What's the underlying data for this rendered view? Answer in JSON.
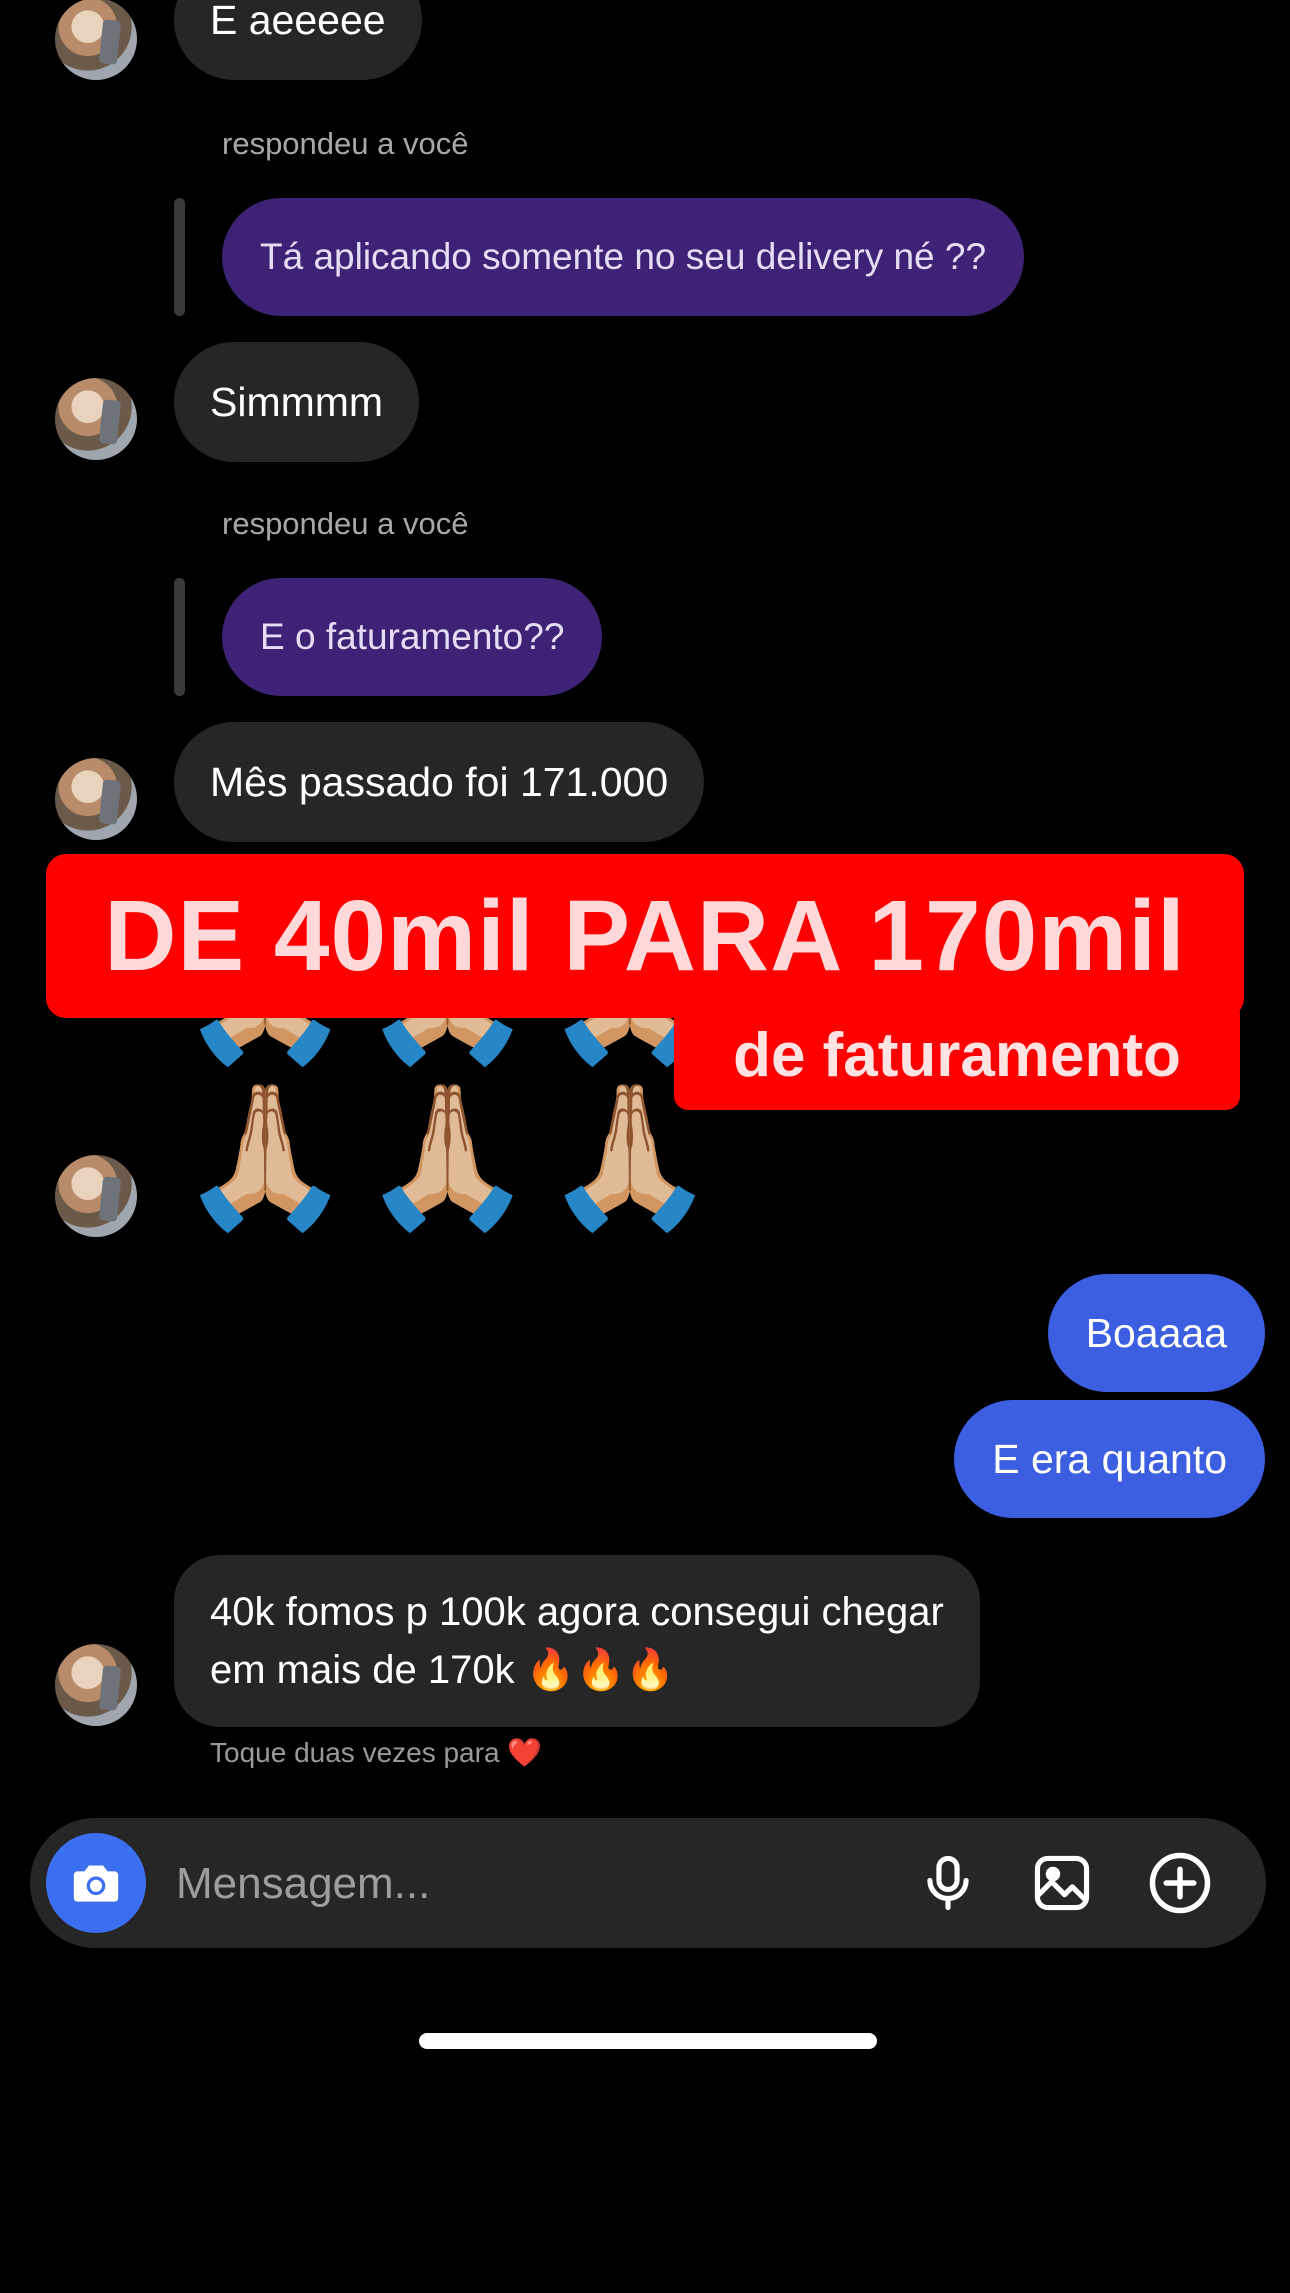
{
  "messages": {
    "m1": "E aeeeee",
    "reply_label_1": "respondeu a você",
    "reply_1": "Tá aplicando somente no seu delivery né ??",
    "m2": "Simmmm",
    "reply_label_2": "respondeu a você",
    "reply_2": "E o faturamento??",
    "m3": "Mês passado foi 171.000",
    "pray_row": "🙏🏼🙏🏼🙏🏼",
    "out_1": "Boaaaa",
    "out_2": "E era quanto",
    "m4_line1": "40k fomos p 100k agora consegui chegar",
    "m4_line2": "em mais de 170k 🔥🔥🔥"
  },
  "overlay": {
    "headline": "DE 40mil PARA 170mil",
    "subheadline": "de faturamento"
  },
  "hint": "Toque duas vezes para ❤️",
  "composer": {
    "placeholder": "Mensagem...",
    "icons": [
      "camera-icon",
      "microphone-icon",
      "image-icon",
      "plus-circle-icon"
    ]
  },
  "colors": {
    "background": "#000000",
    "incoming_bubble": "#262626",
    "reply_bubble": "#3e2275",
    "outgoing_bubble": "#3b5fe0",
    "overlay_red": "#ff0000",
    "camera_button": "#3b6ff0"
  }
}
